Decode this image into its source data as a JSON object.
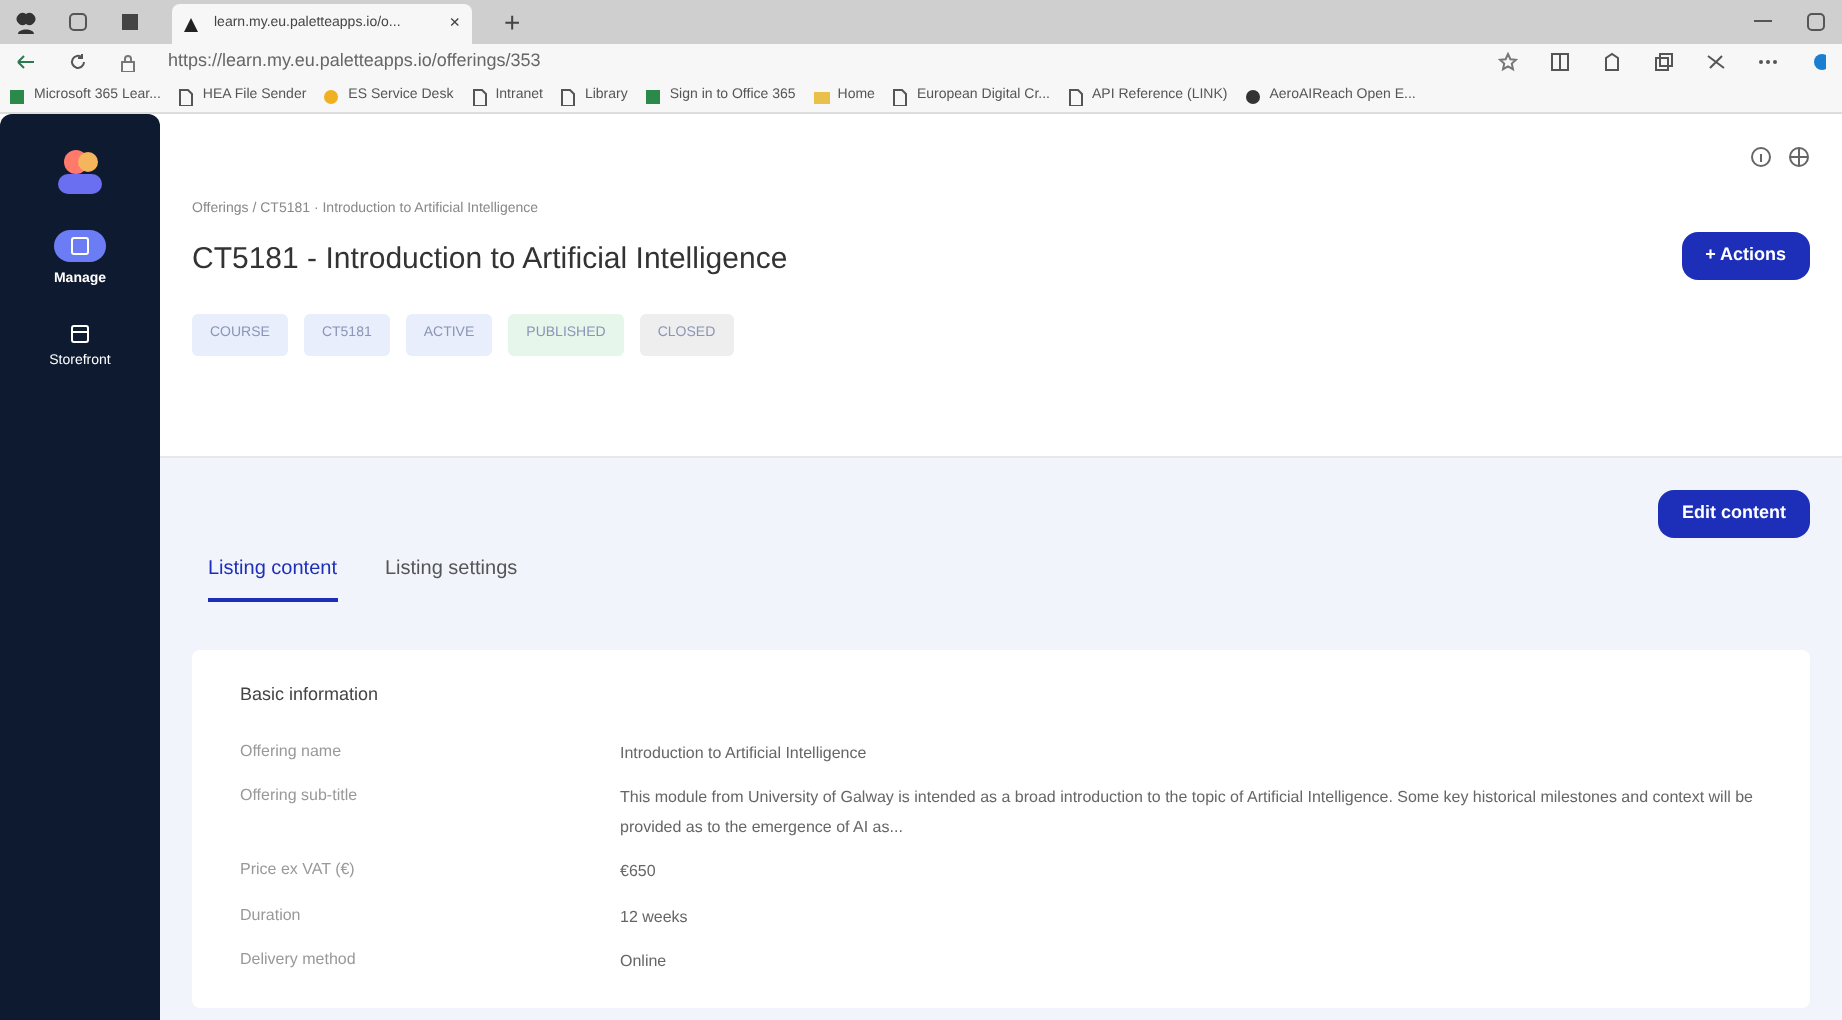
{
  "browser": {
    "tab_title": "learn.my.eu.paletteapps.io/o...",
    "tab_close": "×",
    "new_tab": "+",
    "url": "https://learn.my.eu.paletteapps.io/offerings/353",
    "bookmarks": [
      {
        "label": "Microsoft 365 Lear...",
        "kind": "app"
      },
      {
        "label": "HEA File Sender",
        "kind": "page"
      },
      {
        "label": "ES Service Desk",
        "kind": "sun"
      },
      {
        "label": "Intranet",
        "kind": "page"
      },
      {
        "label": "Library",
        "kind": "page"
      },
      {
        "label": "Sign in to Office 365",
        "kind": "app"
      },
      {
        "label": "Home",
        "kind": "folder"
      },
      {
        "label": "European Digital Cr...",
        "kind": "page"
      },
      {
        "label": "API Reference (LINK)",
        "kind": "page"
      },
      {
        "label": "AeroAIReach Open E...",
        "kind": "globe"
      }
    ]
  },
  "sidebar": {
    "items": [
      {
        "label": "Manage",
        "selected": true
      },
      {
        "label": "Storefront",
        "selected": false
      }
    ]
  },
  "header": {
    "breadcrumb": "Offerings / CT5181 · Introduction to Artificial Intelligence",
    "title": "CT5181 - Introduction to Artificial Intelligence",
    "actions_button": "+ Actions",
    "tags": [
      {
        "label": "COURSE",
        "color": "#e8eefb"
      },
      {
        "label": "CT5181",
        "color": "#e8eefb"
      },
      {
        "label": "ACTIVE",
        "color": "#e8eefb"
      },
      {
        "label": "PUBLISHED",
        "color": "#e6f6ea"
      },
      {
        "label": "CLOSED",
        "color": "#eeeeee"
      }
    ]
  },
  "edit_button": "Edit content",
  "tabs": [
    {
      "label": "Listing content",
      "selected": true
    },
    {
      "label": "Listing settings",
      "selected": false
    }
  ],
  "card": {
    "title": "Basic information",
    "rows": [
      {
        "label": "Offering name",
        "value": "Introduction to Artificial Intelligence"
      },
      {
        "label": "Offering sub-title",
        "value": "This module from University of Galway is intended as a broad introduction to the topic of Artificial Intelligence. Some key historical milestones and context will be provided as to the emergence of AI as..."
      },
      {
        "label": "Price ex VAT (€)",
        "value": "€650"
      },
      {
        "label": "Duration",
        "value": "12 weeks"
      },
      {
        "label": "Delivery method",
        "value": "Online"
      }
    ]
  }
}
